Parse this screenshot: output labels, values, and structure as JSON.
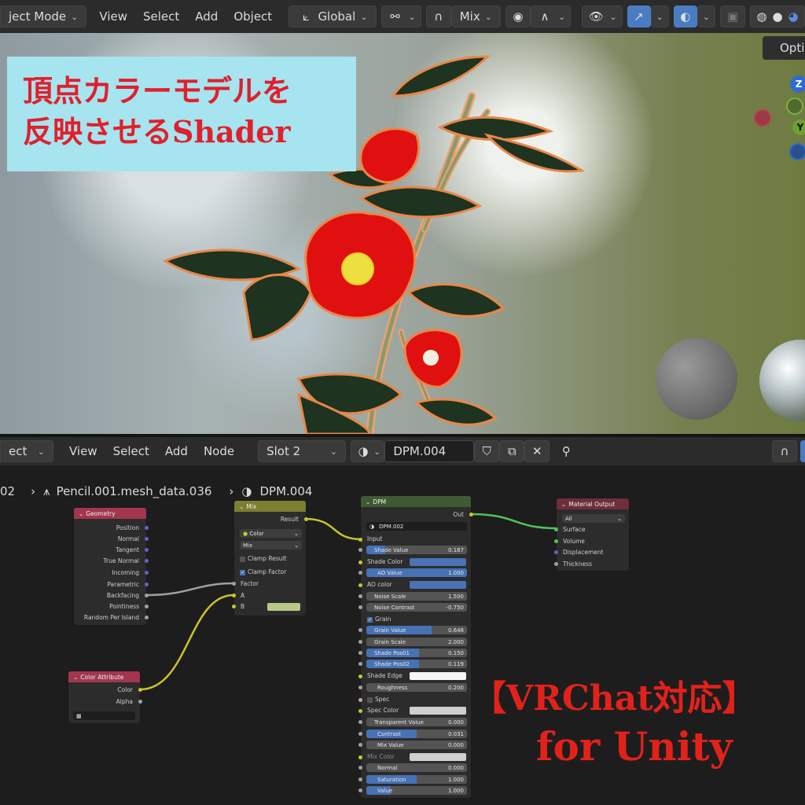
{
  "viewport_header": {
    "mode": "ject Mode",
    "menus": [
      "View",
      "Select",
      "Add",
      "Object"
    ],
    "orientation": "Global",
    "blend": "Mix",
    "options": "Opti"
  },
  "overlay": {
    "title_line1": "頂点カラーモデルを",
    "title_line2": "反映させるShader",
    "vrchat": "【VRChat対応】",
    "unity": "for Unity"
  },
  "gizmo": {
    "z": "Z",
    "y": "Y"
  },
  "node_header": {
    "mode": "ect",
    "menus": [
      "View",
      "Select",
      "Add",
      "Node"
    ],
    "slot": "Slot 2",
    "material": "DPM.004"
  },
  "breadcrumb": {
    "object": "02",
    "mesh": "Pencil.001.mesh_data.036",
    "material": "DPM.004"
  },
  "nodes": {
    "geometry": {
      "title": "Geometry",
      "outputs": [
        "Position",
        "Normal",
        "Tangent",
        "True Normal",
        "Incoming",
        "Parametric",
        "Backfacing",
        "Pointiness",
        "Random Per Island"
      ]
    },
    "mix": {
      "title": "Mix",
      "output": "Result",
      "data_type": "Color",
      "blend": "Mix",
      "clamp_result": "Clamp Result",
      "clamp_factor": "Clamp Factor",
      "inputs": [
        "Factor",
        "A",
        "B"
      ]
    },
    "color_attribute": {
      "title": "Color Attribute",
      "outputs": [
        "Color",
        "Alpha"
      ]
    },
    "dpm": {
      "title": "DPM",
      "output": "Out",
      "group": "DPM.002",
      "input": "Input",
      "shade_value": {
        "label": "Shade Value",
        "value": "0.187",
        "fill": 0.19
      },
      "shade_color": "Shade Color",
      "ao_value": {
        "label": "AO Value",
        "value": "1.000"
      },
      "ao_color": "AO color",
      "noise_scale": {
        "label": "Noise Scale",
        "value": "1.500"
      },
      "noise_contrast": {
        "label": "Noise Contrast",
        "value": "-0.750"
      },
      "grain": "Grain",
      "grain_value": {
        "label": "Grain Value",
        "value": "0.648",
        "fill": 0.65
      },
      "grain_scale": {
        "label": "Grain Scale",
        "value": "2.000"
      },
      "shade_pos01": {
        "label": "Shade Pos01",
        "value": "0.150"
      },
      "shade_pos02": {
        "label": "Shade Pos02",
        "value": "0.119"
      },
      "shade_edge": "Shade Edge",
      "roughness": {
        "label": "Roughness",
        "value": "0.200"
      },
      "spec": "Spec",
      "spec_color": "Spec Color",
      "transparent_value": {
        "label": "Transparent Value",
        "value": "0.000"
      },
      "contrast": {
        "label": "Contrast",
        "value": "0.031"
      },
      "mix_value": {
        "label": "Mix Value",
        "value": "0.000"
      },
      "mix_color": "Mix Color",
      "normal": {
        "label": "Normal",
        "value": "0.000"
      },
      "saturation": {
        "label": "Saturation",
        "value": "1.000"
      },
      "value": {
        "label": "Value",
        "value": "1.000"
      }
    },
    "material_output": {
      "title": "Material Output",
      "target": "All",
      "inputs": [
        "Surface",
        "Volume",
        "Displacement",
        "Thickness"
      ]
    }
  },
  "colors": {
    "header_geometry": "#a2364e",
    "header_mix": "#7a8030",
    "header_dpm": "#3e5a32",
    "header_output": "#6e2e3a",
    "header_color_attr": "#a2364e",
    "link_yellow": "#c9c22f",
    "link_green": "#4ec35a",
    "link_gray": "#a0a0a0"
  }
}
